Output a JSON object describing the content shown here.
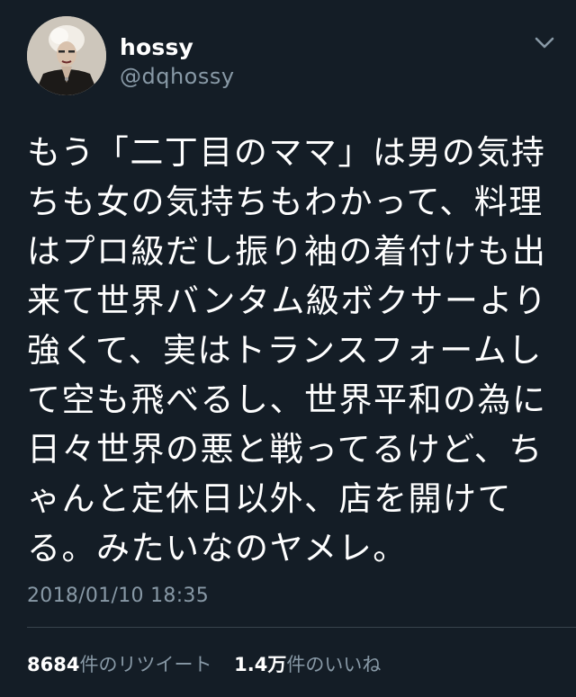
{
  "user": {
    "display_name": "hossy",
    "handle": "@dqhossy"
  },
  "tweet": {
    "lines": [
      "もう「二丁目のママ」は男の気持",
      "ちも女の気持ちもわかって、料理",
      "はプロ級だし振り袖の着付けも出",
      "来て世界バンタム級ボクサーより",
      "強くて、実はトランスフォームし",
      "て空も飛べるし、世界平和の為に",
      "日々世界の悪と戦ってるけど、ち",
      "ゃんと定休日以外、店を開けて",
      "る。みたいなのヤメレ。"
    ],
    "timestamp": "2018/01/10 18:35"
  },
  "stats": {
    "retweets": {
      "count": "8684",
      "label": "件のリツイート"
    },
    "likes": {
      "count": "1.4万",
      "label": "件のいいね"
    }
  },
  "icons": {
    "menu": "chevron-down-icon",
    "avatar": "avatar"
  },
  "colors": {
    "background": "#141d26",
    "text_primary": "#ffffff",
    "text_secondary": "#8899a6",
    "divider": "#38444d"
  }
}
